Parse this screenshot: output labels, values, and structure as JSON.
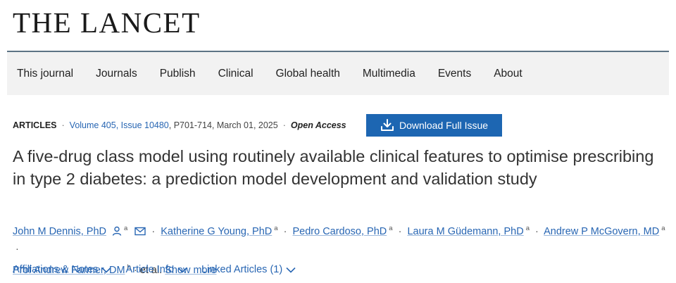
{
  "logo": "THE LANCET",
  "nav": [
    "This journal",
    "Journals",
    "Publish",
    "Clinical",
    "Global health",
    "Multimedia",
    "Events",
    "About"
  ],
  "meta": {
    "type": "ARTICLES",
    "volume": "Volume 405, Issue 10480",
    "pages_date": ", P701-714, March 01, 2025",
    "access": "Open Access",
    "download_label": "Download Full Issue"
  },
  "title": "A five-drug class model using routinely available clinical features to optimise prescribing in type 2 diabetes: a prediction model development and validation study",
  "authors": [
    {
      "name": "John M Dennis, PhD",
      "sup": "a"
    },
    {
      "name": "Katherine G Young, PhD",
      "sup": "a"
    },
    {
      "name": "Pedro Cardoso, PhD",
      "sup": "a"
    },
    {
      "name": "Laura M Güdemann, PhD",
      "sup": "a"
    },
    {
      "name": "Andrew P McGovern, MD",
      "sup": "a"
    },
    {
      "name": "Prof Andrew Farmer, DM",
      "sup": "b"
    }
  ],
  "et_al": "et al.",
  "show_more": "Show more",
  "subnav": [
    "Affiliations & Notes",
    "Article Info",
    "Linked Articles (1)"
  ],
  "colors": {
    "link": "#2866b3",
    "button": "#1d66b2",
    "nav_bg": "#f2f2f2",
    "rule": "#5c7384"
  },
  "icons": {
    "author_person": "person-icon",
    "author_email": "email-icon",
    "download": "download-icon",
    "chevron": "chevron-down-icon"
  }
}
